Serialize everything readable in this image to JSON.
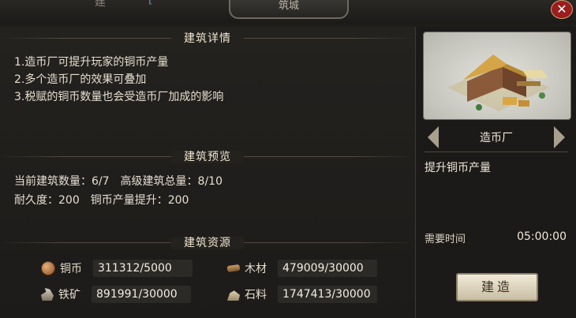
{
  "window": {
    "top_ghost_text": "建",
    "top_ghost_tag": "[",
    "title": "筑城",
    "close_label": "✕"
  },
  "details": {
    "header": "建筑详情",
    "lines": [
      "1.造币厂可提升玩家的铜币产量",
      "2.多个造币厂的效果可叠加",
      "3.税赋的铜币数量也会受造币厂加成的影响"
    ]
  },
  "preview": {
    "header": "建筑预览",
    "build_count_label": "当前建筑数量：",
    "build_count": "6/7",
    "advanced_total_label": "高级建筑总量：",
    "advanced_total": "8/10",
    "durability_label": "耐久度：",
    "durability": "200",
    "copper_boost_label": "铜币产量提升：",
    "copper_boost": "200"
  },
  "resources": {
    "header": "建筑资源",
    "items": [
      {
        "name": "铜币",
        "value": "311312/5000",
        "icon": "copper-coin-icon"
      },
      {
        "name": "木材",
        "value": "479009/30000",
        "icon": "wood-icon"
      },
      {
        "name": "铁矿",
        "value": "891991/30000",
        "icon": "iron-ore-icon"
      },
      {
        "name": "石料",
        "value": "1747413/30000",
        "icon": "stone-icon"
      }
    ]
  },
  "building": {
    "name": "造币厂",
    "description": "提升铜币产量",
    "time_label": "需要时间",
    "time_value": "05:00:00",
    "build_button": "建造"
  },
  "colors": {
    "background": "#1f1d1a",
    "close_button": "#9c1d1d",
    "build_button": "#e8dfc8"
  }
}
